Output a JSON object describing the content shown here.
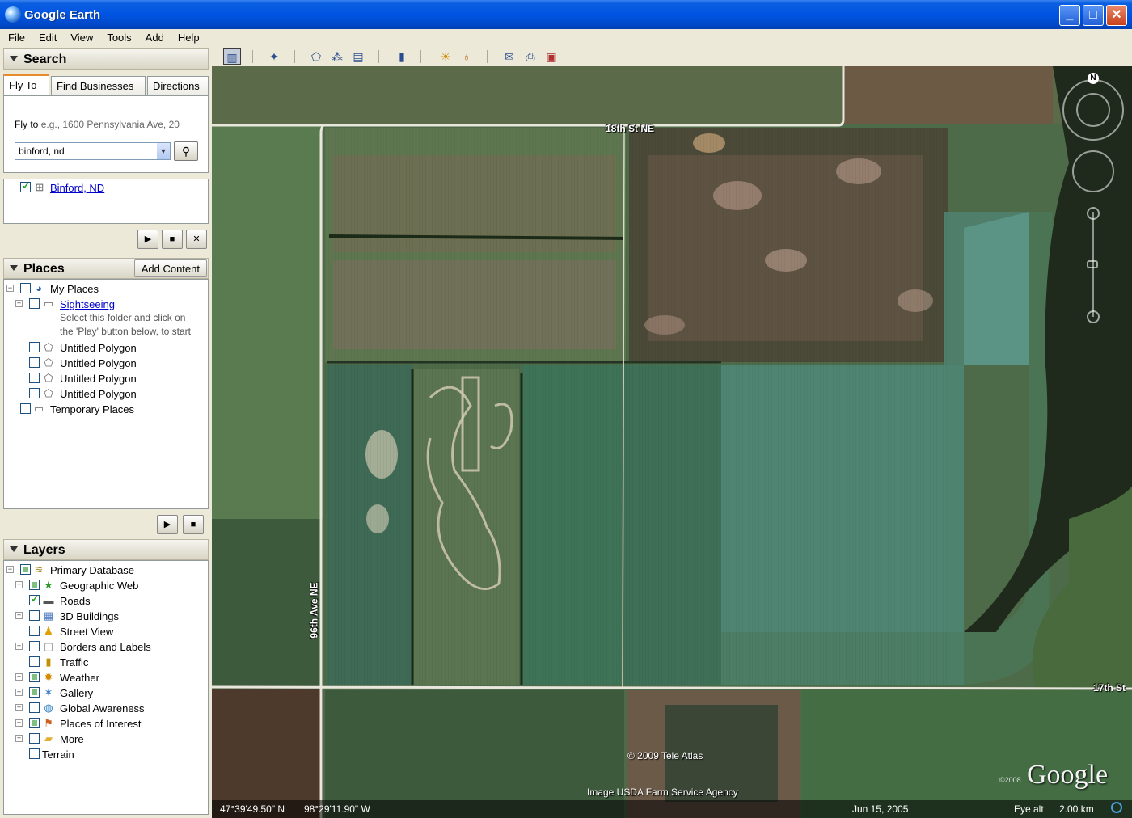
{
  "window": {
    "title": "Google Earth"
  },
  "menu": [
    "File",
    "Edit",
    "View",
    "Tools",
    "Add",
    "Help"
  ],
  "search": {
    "header": "Search",
    "tabs": [
      "Fly To",
      "Find Businesses",
      "Directions"
    ],
    "flyto_label": "Fly to",
    "flyto_placeholder": "e.g., 1600 Pennsylvania Ave, 20",
    "query": "binford, nd",
    "result": "Binford, ND"
  },
  "places": {
    "header": "Places",
    "add_content": "Add Content",
    "my_places": "My Places",
    "sightseeing": "Sightseeing",
    "sightseeing_desc_1": "Select this folder and click on",
    "sightseeing_desc_2": "the 'Play' button below, to start",
    "polygons": [
      "Untitled Polygon",
      "Untitled Polygon",
      "Untitled Polygon",
      "Untitled Polygon"
    ],
    "temporary": "Temporary Places"
  },
  "layers": {
    "header": "Layers",
    "primary": "Primary Database",
    "items": [
      {
        "label": "Geographic Web",
        "icon": "star-icon",
        "state": "partial",
        "expand": true
      },
      {
        "label": "Roads",
        "icon": "road-icon",
        "state": "checked",
        "expand": false
      },
      {
        "label": "3D Buildings",
        "icon": "building-icon",
        "state": "none",
        "expand": true
      },
      {
        "label": "Street View",
        "icon": "pegman-icon",
        "state": "none",
        "expand": false
      },
      {
        "label": "Borders and Labels",
        "icon": "border-icon",
        "state": "none",
        "expand": true
      },
      {
        "label": "Traffic",
        "icon": "traffic-icon",
        "state": "none",
        "expand": false
      },
      {
        "label": "Weather",
        "icon": "sun-icon",
        "state": "partial",
        "expand": true
      },
      {
        "label": "Gallery",
        "icon": "gallery-icon",
        "state": "partial",
        "expand": true
      },
      {
        "label": "Global Awareness",
        "icon": "globe-icon",
        "state": "none",
        "expand": true
      },
      {
        "label": "Places of Interest",
        "icon": "flag-icon",
        "state": "partial",
        "expand": true
      },
      {
        "label": "More",
        "icon": "folder-icon",
        "state": "none",
        "expand": true
      }
    ],
    "terrain": "Terrain"
  },
  "map": {
    "road_18th": "18th St NE",
    "road_96th": "96th Ave NE",
    "road_17th": "17th St",
    "copyright": "© 2009 Tele Atlas",
    "imagery": "Image USDA Farm Service Agency",
    "logo": "Google",
    "logo_year": "©2008",
    "compass_n": "N"
  },
  "status": {
    "lat": "47°39'49.50\" N",
    "lon": "98°29'11.90\" W",
    "date": "Jun 15, 2005",
    "eye_alt_label": "Eye alt",
    "eye_alt": "2.00 km"
  }
}
